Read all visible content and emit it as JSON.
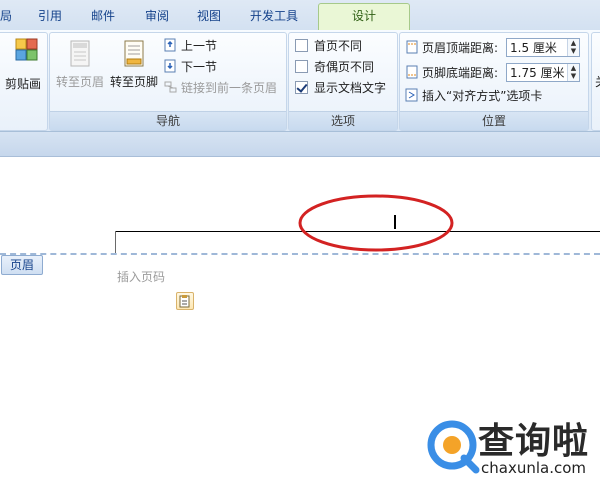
{
  "tabs": [
    {
      "label": "局",
      "active": false
    },
    {
      "label": "引用",
      "active": false
    },
    {
      "label": "邮件",
      "active": false
    },
    {
      "label": "审阅",
      "active": false
    },
    {
      "label": "视图",
      "active": false
    },
    {
      "label": "开发工具",
      "active": false
    },
    {
      "label": "设计",
      "active": true
    }
  ],
  "ribbon": {
    "clipart": {
      "label": "剪贴画"
    },
    "navigation": {
      "group_label": "导航",
      "goto_header": "转至页眉",
      "goto_footer": "转至页脚",
      "prev_section": "上一节",
      "next_section": "下一节",
      "link_previous": "链接到前一条页眉"
    },
    "options": {
      "group_label": "选项",
      "items": [
        {
          "label": "首页不同",
          "checked": false
        },
        {
          "label": "奇偶页不同",
          "checked": false
        },
        {
          "label": "显示文档文字",
          "checked": true
        }
      ]
    },
    "position": {
      "group_label": "位置",
      "header_top_label": "页眉顶端距离:",
      "header_top_value": "1.5 厘米",
      "footer_bottom_label": "页脚底端距离:",
      "footer_bottom_value": "1.75 厘米",
      "insert_align_tab": "插入“对齐方式”选项卡"
    },
    "partial_right": "关"
  },
  "document": {
    "header_tag": "页眉",
    "insert_page_number": "插入页码"
  },
  "watermark": {
    "cn": "查询啦",
    "en": "chaxunla.com"
  },
  "colors": {
    "accent": "#15428b",
    "design_tab": "#eaf7d6",
    "annotation": "#d32222",
    "watermark_blue": "#3a8ee6"
  }
}
